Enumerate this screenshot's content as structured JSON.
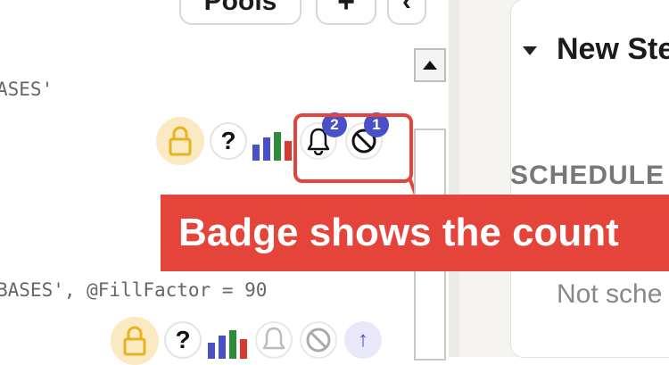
{
  "toolbar": {
    "pools_label": "Pools",
    "add_label": "+",
    "collapse_label": "‹"
  },
  "code_lines": {
    "line1": "ASES'",
    "line2": "BASES', @FillFactor = 90"
  },
  "row1": {
    "help_label": "?",
    "bell_badge": "2",
    "ban_badge": "1"
  },
  "row2": {
    "help_label": "?",
    "arrow_label": "↑"
  },
  "right_panel": {
    "step_title": "New Ste",
    "section_heading": "SCHEDULE",
    "schedule_status": "Not sche"
  },
  "annotation": {
    "callout_text": "Badge shows the count"
  },
  "colors": {
    "accent_red": "#e5443a",
    "badge_blue": "#4a50c8",
    "bar_blue": "#4a50c8",
    "bar_green": "#2e8b3a",
    "bar_red": "#d63a33",
    "lock_gold": "#e8b21e"
  },
  "icons": [
    "lock-icon",
    "help-icon",
    "bar-chart-icon",
    "bell-icon",
    "ban-icon",
    "arrow-up-icon",
    "caret-down-icon",
    "scroll-up-icon"
  ]
}
